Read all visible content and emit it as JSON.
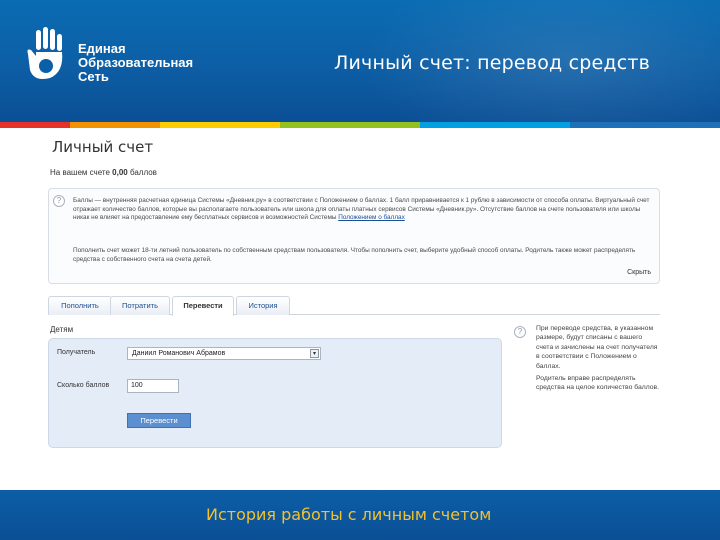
{
  "header": {
    "logo_lines": [
      "Единая",
      "Образовательная",
      "Сеть"
    ],
    "slide_title": "Личный счет: перевод средств"
  },
  "stripe_colors": [
    "#e6332a",
    "#f39200",
    "#ffcc00",
    "#95c11f",
    "#00a0e3",
    "#1d71b8"
  ],
  "page": {
    "title": "Личный счет",
    "balance_prefix": "На вашем счете ",
    "balance_value": "0,00",
    "balance_suffix": " баллов"
  },
  "info": {
    "para1": "Баллы — внутренняя расчетная единица Системы «Дневник.ру» в соответствии с Положением о баллах. 1 балл приравнивается к 1 рублю в зависимости от способа оплаты. Виртуальный счет отражает количество баллов, которые вы располагаете пользователь или школа для оплаты платных сервисов Системы «Дневник.ру». Отсутствие баллов на счете пользователя или школы никак не влияет на предоставление ему бесплатных сервисов и возможностей Системы",
    "para1_link": "Положением о баллах",
    "para2": "Пополнить счет может 18-ти летний пользователь по собственным средствам пользователя. Чтобы пополнить счет, выберите удобный способ оплаты. Родитель также может распределять средства с собственного счета на счета детей.",
    "hide_label": "Скрыть"
  },
  "tabs": [
    {
      "label": "Пополнить",
      "active": false
    },
    {
      "label": "Потратить",
      "active": false
    },
    {
      "label": "Перевести",
      "active": true
    },
    {
      "label": "История",
      "active": false
    }
  ],
  "form": {
    "section_label": "Детям",
    "recipient_label": "Получатель",
    "recipient_value": "Даниил Романович Абрамов",
    "amount_label": "Сколько баллов",
    "amount_value": "100",
    "submit_label": "Перевести"
  },
  "side_help": {
    "p1": "При переводе средства, в указанном размере, будут списаны с вашего счета и зачислены на счет получателя в соответствии с Положением о баллах.",
    "p2": "Родитель вправе распределять средства на целое количество баллов."
  },
  "footer": {
    "text": "История работы с личным счетом"
  }
}
